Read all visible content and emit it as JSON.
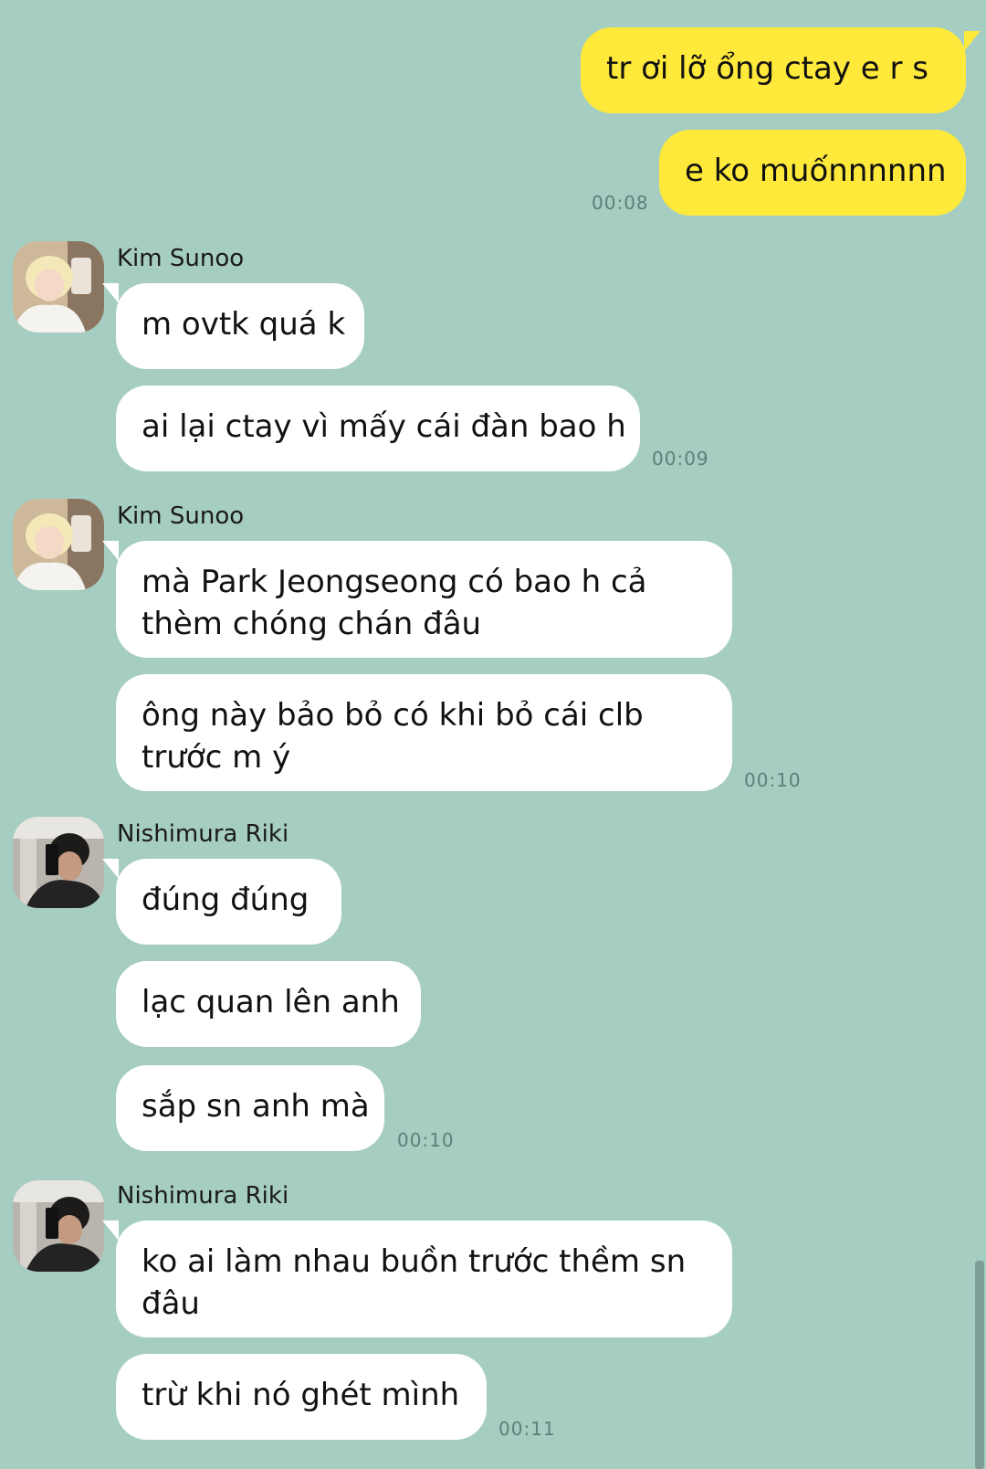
{
  "outgoing": {
    "messages": [
      "tr ơi lỡ ổng ctay e r s",
      "e ko muốnnnnnn"
    ],
    "time": "00:08"
  },
  "groups": [
    {
      "sender": "Kim Sunoo",
      "avatar": "sunoo-avatar",
      "messages": [
        "m ovtk quá k",
        "ai lại ctay vì mấy cái đàn bao h"
      ],
      "time": "00:09"
    },
    {
      "sender": "Kim Sunoo",
      "avatar": "sunoo-avatar",
      "messages": [
        "mà Park Jeongseong có bao h cả thèm chóng chán đâu",
        "ông này bảo bỏ có khi bỏ cái clb trước m ý"
      ],
      "time": "00:10"
    },
    {
      "sender": "Nishimura Riki",
      "avatar": "riki-avatar",
      "messages": [
        "đúng đúng",
        "lạc quan lên anh",
        "sắp sn anh mà"
      ],
      "time": "00:10"
    },
    {
      "sender": "Nishimura Riki",
      "avatar": "riki-avatar",
      "messages": [
        "ko ai làm nhau buồn trước thềm sn đâu",
        "trừ khi nó ghét mình"
      ],
      "time": "00:11"
    }
  ],
  "colors": {
    "background": "#a6cdc1",
    "outgoing_bubble": "#ffe93a",
    "incoming_bubble": "#ffffff"
  }
}
